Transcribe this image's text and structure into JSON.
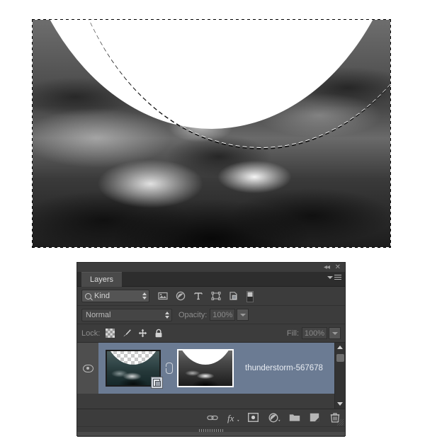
{
  "document": {
    "image_alt": "thunderstorm clouds with elliptical selection",
    "selection": "marching-ants elliptical selection"
  },
  "panel": {
    "titlebar": {
      "collapse_label": "◂◂",
      "close_label": "✕"
    },
    "tab_label": "Layers",
    "menu_icon": "panel-menu-icon",
    "filter": {
      "kind_label": "Kind",
      "search_icon": "search-icon",
      "icons": [
        {
          "name": "filter-pixel-icon",
          "label": "Pixel layers"
        },
        {
          "name": "filter-adjustment-icon",
          "label": "Adjustment layers"
        },
        {
          "name": "filter-type-icon",
          "label": "Type layers"
        },
        {
          "name": "filter-shape-icon",
          "label": "Shape layers"
        },
        {
          "name": "filter-smartobject-icon",
          "label": "Smart objects"
        },
        {
          "name": "filter-toggle-icon",
          "label": "Filter toggle"
        }
      ]
    },
    "blend": {
      "mode_value": "Normal",
      "opacity_label": "Opacity:",
      "opacity_value": "100%"
    },
    "lock": {
      "label": "Lock:",
      "fill_label": "Fill:",
      "fill_value": "100%",
      "icons": [
        {
          "name": "lock-transparent-pixels-icon"
        },
        {
          "name": "lock-image-pixels-icon"
        },
        {
          "name": "lock-position-icon"
        },
        {
          "name": "lock-all-icon"
        }
      ]
    },
    "layers": [
      {
        "name": "thunderstorm-567678",
        "visible": true,
        "selected": true,
        "linked": true,
        "has_mask": true,
        "is_smart_object": true
      }
    ],
    "footer_buttons": [
      {
        "name": "link-layers-button",
        "label": "∞"
      },
      {
        "name": "layer-style-button",
        "label": "fx"
      },
      {
        "name": "add-layer-mask-button",
        "label": "mask"
      },
      {
        "name": "new-adjustment-layer-button",
        "label": "adjust"
      },
      {
        "name": "new-group-button",
        "label": "folder"
      },
      {
        "name": "new-layer-button",
        "label": "new"
      },
      {
        "name": "delete-layer-button",
        "label": "trash"
      }
    ]
  },
  "colors": {
    "panel_bg": "#3c3c3c",
    "panel_dark": "#2d2d2d",
    "selected_row": "#6b7b93",
    "text": "#c8c8c8",
    "text_dim": "#8e8e8e"
  }
}
